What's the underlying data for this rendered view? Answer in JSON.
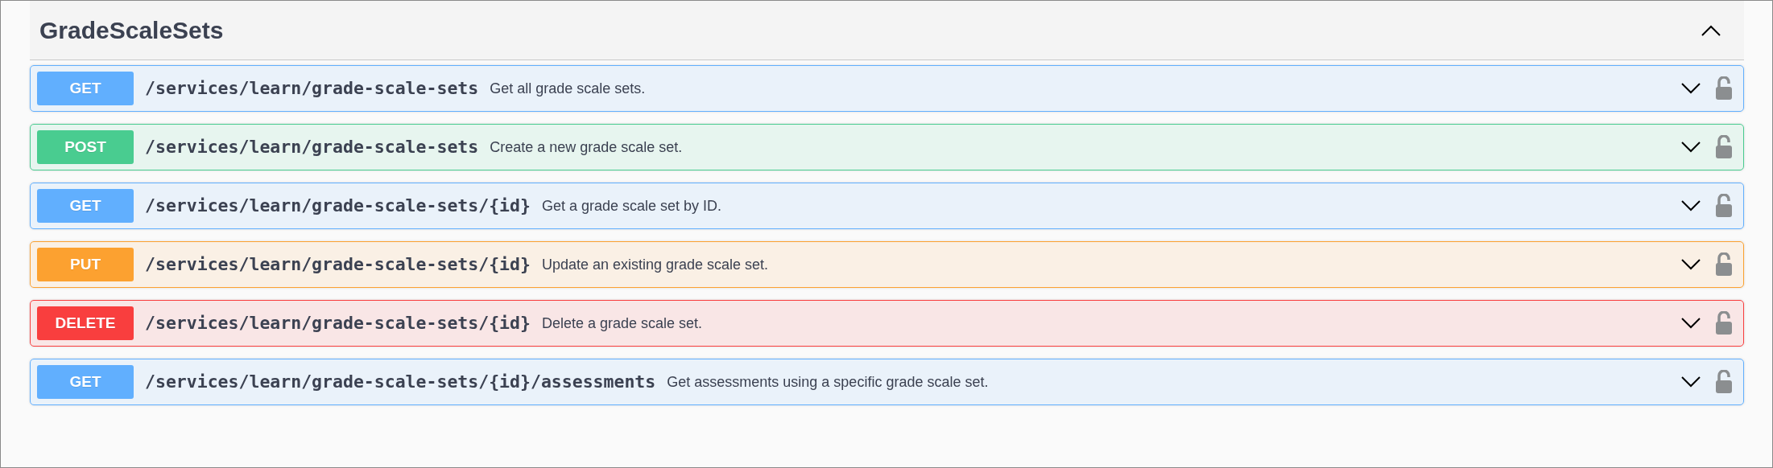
{
  "section": {
    "title": "GradeScaleSets",
    "expanded": true
  },
  "operations": [
    {
      "method": "GET",
      "color": "#61affe",
      "path": "/services/learn/grade-scale-sets",
      "summary": "Get all grade scale sets.",
      "expanded": false,
      "locked": false
    },
    {
      "method": "POST",
      "color": "#49cc90",
      "path": "/services/learn/grade-scale-sets",
      "summary": "Create a new grade scale set.",
      "expanded": false,
      "locked": false
    },
    {
      "method": "GET",
      "color": "#61affe",
      "path": "/services/learn/grade-scale-sets/{id}",
      "summary": "Get a grade scale set by ID.",
      "expanded": false,
      "locked": false
    },
    {
      "method": "PUT",
      "color": "#fca130",
      "path": "/services/learn/grade-scale-sets/{id}",
      "summary": "Update an existing grade scale set.",
      "expanded": false,
      "locked": false
    },
    {
      "method": "DELETE",
      "color": "#f93e3e",
      "path": "/services/learn/grade-scale-sets/{id}",
      "summary": "Delete a grade scale set.",
      "expanded": false,
      "locked": false
    },
    {
      "method": "GET",
      "color": "#61affe",
      "path": "/services/learn/grade-scale-sets/{id}/assessments",
      "summary": "Get assessments using a specific grade scale set.",
      "expanded": false,
      "locked": false
    }
  ]
}
